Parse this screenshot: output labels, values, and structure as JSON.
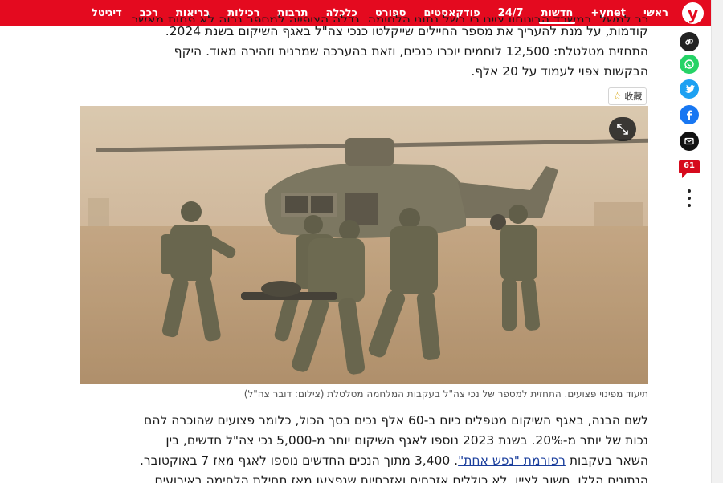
{
  "nav": {
    "logo": "y",
    "items": [
      "ראשי",
      "ynet+",
      "חדשות",
      "24/7",
      "פודקאסטים",
      "ספורט",
      "כלכלה",
      "תרבות",
      "רכילות",
      "בריאות",
      "רכב",
      "דיגיטל"
    ],
    "active_index": 2
  },
  "article": {
    "para1_line0": "כך למשל, במשרד הביטחון ציינו כי בשל נתוני הלחימה, גדלה הציפייה למספר גבוה לא פחות מאשר בשנים",
    "para1_line1": "קודמות, על מנת להעריך את מספר החיילים שייקלטו כנכי צה\"ל באגף השיקום בשנת 2024.",
    "para1_line2": "התחזית מטלטלת: 12,500 לוחמים יוכרו כנכים, וזאת בהערכה שמרנית וזהירה מאוד. היקף",
    "para1_line3": "הבקשות צפוי לעמוד על 20 אלף.",
    "bookmark_label": "收藏",
    "caption": "תיעוד מפינוי פצועים. התחזית למספר של נכי צה\"ל בעקבות המלחמה מטלטלת (צילום: דובר צה\"ל)",
    "para2_line0": "לשם הבנה, באגף השיקום מטפלים כיום ב-60 אלף נכים בסך הכול, כלומר פצועים שהוכרה להם",
    "para2_line1": "נכות של יותר מ-20%. בשנת 2023 נוספו לאגף השיקום יותר מ-5,000 נכי צה\"ל חדשים, בין",
    "para2_line2_pre": "השאר בעקבות ",
    "para2_link": "רפורמת \"נפש אחת\"",
    "para2_line2_post": ". 3,400 מתוך הנכים החדשים נוספו לאגף מאז 7 באוקטובר.",
    "para2_line3": "הנתונים הללו, חשוב לציין, לא כוללים אזרחים ואזרחיות שנפצעו מאז תחילת הלחימה באירועים"
  },
  "rail": {
    "comment_count": "61",
    "icons": [
      "link-icon",
      "whatsapp-icon",
      "twitter-icon",
      "facebook-icon",
      "email-icon",
      "comments-icon",
      "more-icon"
    ]
  },
  "colors": {
    "brand_red": "#e40a1f",
    "link_blue": "#1a3e9c"
  }
}
